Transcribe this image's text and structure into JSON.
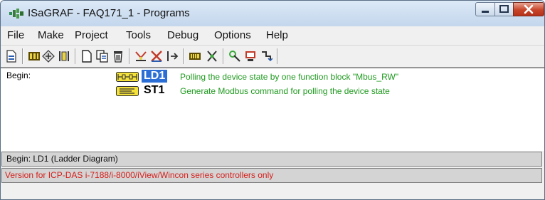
{
  "window": {
    "title": "ISaGRAF - FAQ171_1 - Programs",
    "controls": {
      "minimize": "minimize",
      "maximize": "maximize",
      "close": "close"
    }
  },
  "menu": [
    "File",
    "Make",
    "Project",
    "Tools",
    "Debug",
    "Options",
    "Help"
  ],
  "toolbar": {
    "icons": [
      "new-program-icon",
      "dictionary-icon",
      "conversion-tables-icon",
      "io-connection-icon",
      "new-icon",
      "copy-icon",
      "delete-icon",
      "compile-icon",
      "verify-icon",
      "simulate-icon",
      "controller-icon",
      "debug-icon",
      "library-icon",
      "archive-icon",
      "link-icon"
    ]
  },
  "programs": {
    "section_label": "Begin:",
    "items": [
      {
        "name": "LD1",
        "description": "Polling the device state by one function block \"Mbus_RW\"",
        "type_icon": "ladder-diagram-icon",
        "selected": true
      },
      {
        "name": "ST1",
        "description": "Generate Modbus command for polling the device state",
        "type_icon": "structured-text-icon",
        "selected": false
      }
    ]
  },
  "status": {
    "line1": "Begin:  LD1   (Ladder Diagram)",
    "line2": "Version for ICP-DAS i-7188/i-8000/iView/Wincon series controllers only"
  },
  "colors": {
    "selection": "#2b6fd6",
    "description_text": "#1e9a1e",
    "version_text": "#d4201c"
  }
}
